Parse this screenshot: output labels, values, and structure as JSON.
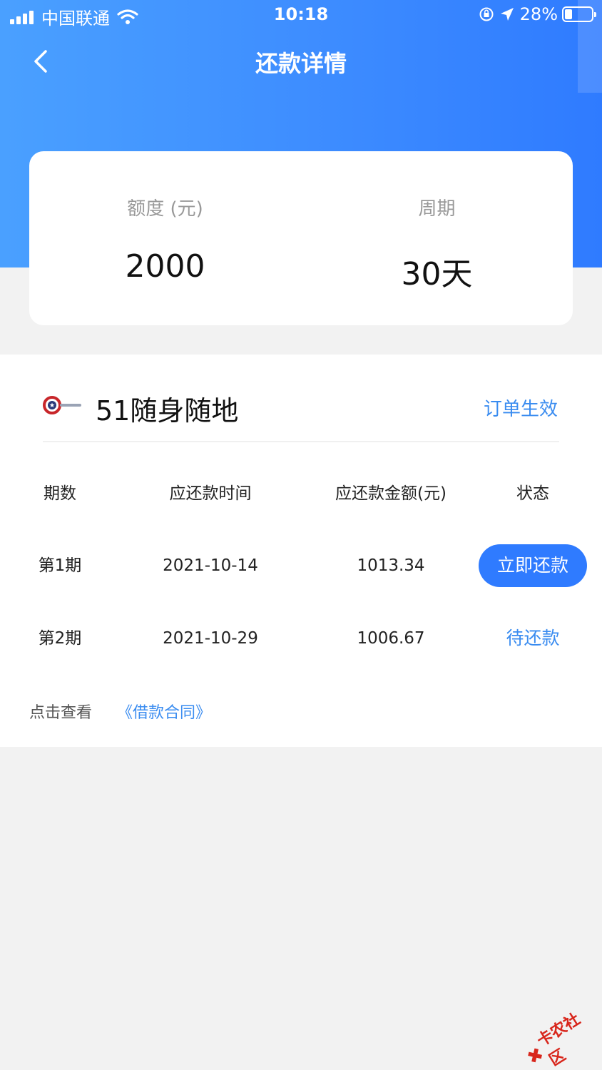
{
  "status_bar": {
    "carrier": "中国联通",
    "time": "10:18",
    "battery": "28%",
    "battery_level": 0.28,
    "icons": [
      "signal-icon",
      "wifi-icon",
      "orientation-lock-icon",
      "location-arrow-icon",
      "battery-icon"
    ]
  },
  "nav": {
    "title": "还款详情",
    "back_icon": "chevron-left-icon"
  },
  "summary": {
    "amount_label": "额度 (元)",
    "amount_value": "2000",
    "period_label": "周期",
    "period_value": "30天"
  },
  "brand": {
    "name": "51随身随地",
    "logo_icon": "brand-logo-icon",
    "order_status": "订单生效"
  },
  "table": {
    "headers": [
      "期数",
      "应还款时间",
      "应还款金额(元)",
      "状态"
    ],
    "rows": [
      {
        "period": "第1期",
        "date": "2021-10-14",
        "amount": "1013.34",
        "status": "立即还款"
      },
      {
        "period": "第2期",
        "date": "2021-10-29",
        "amount": "1006.67",
        "status": "待还款"
      }
    ]
  },
  "contract": {
    "prefix": "点击查看",
    "link": "《借款合同》"
  },
  "watermark": {
    "text": "卡农社区"
  },
  "colors": {
    "primary": "#2f7bff",
    "link": "#3a8cf0",
    "header_gradient_start": "#4aa0ff",
    "header_gradient_end": "#2f7bff",
    "page_bg": "#f2f2f2",
    "watermark": "#d8261c"
  }
}
